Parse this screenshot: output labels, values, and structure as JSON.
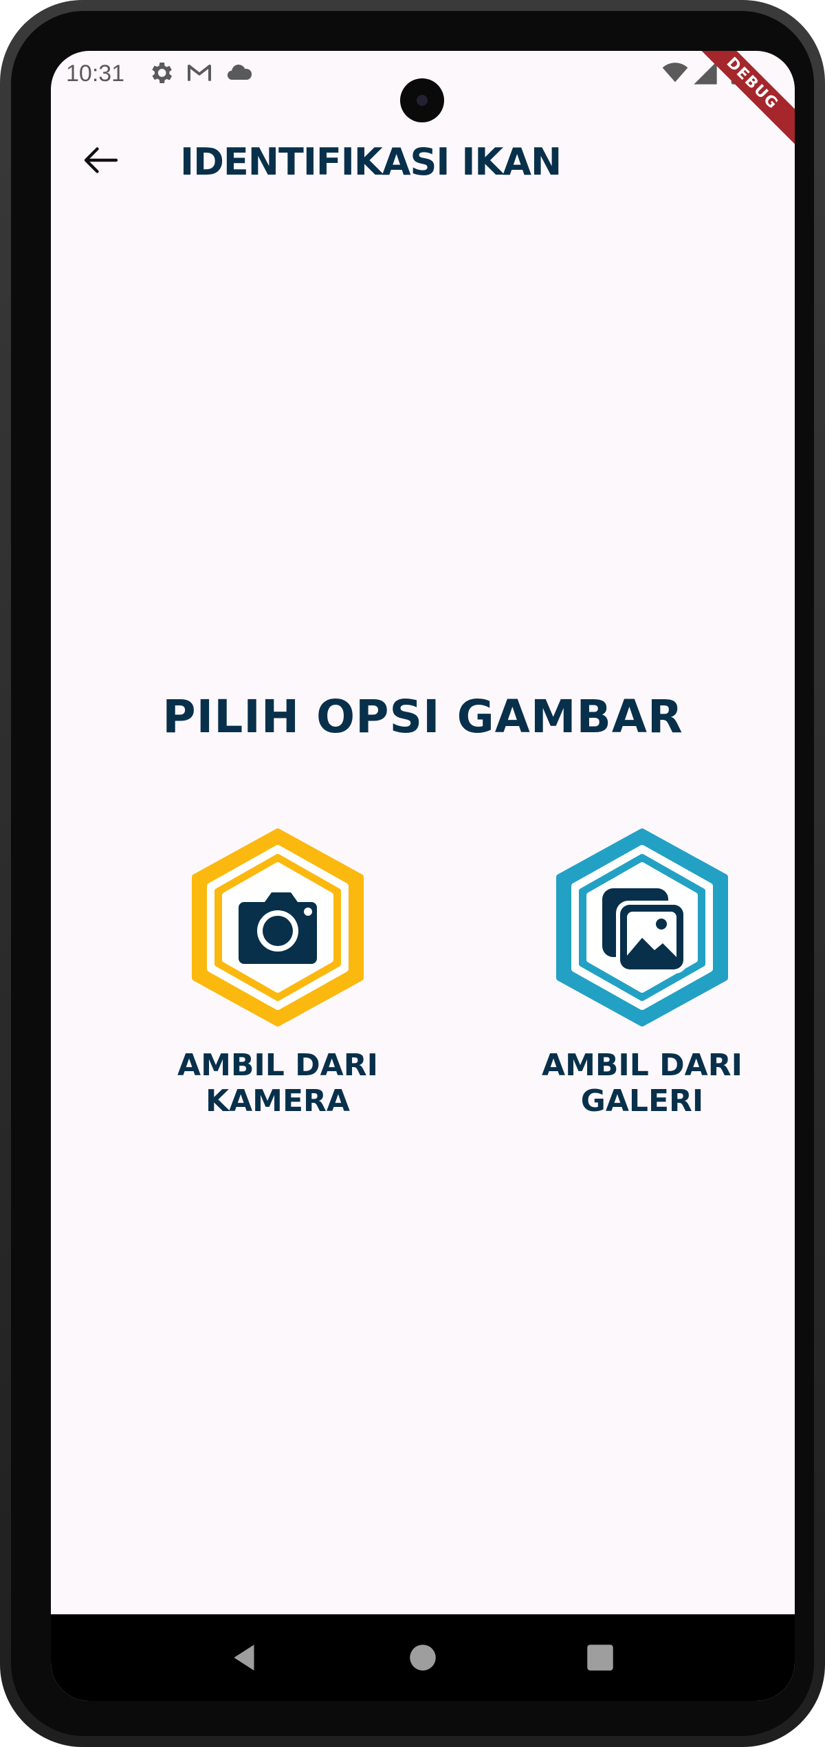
{
  "status_bar": {
    "time": "10:31",
    "icons": [
      "settings-icon",
      "gmail-icon",
      "cloud-icon",
      "wifi-icon",
      "signal-icon",
      "battery-icon"
    ]
  },
  "debug_banner": "DEBUG",
  "app_bar": {
    "title": "IDENTIFIKASI IKAN",
    "back_icon": "arrow-back-icon"
  },
  "content": {
    "heading": "PILIH OPSI GAMBAR",
    "options": [
      {
        "line1": "AMBIL DARI",
        "line2": "KAMERA",
        "icon": "camera-icon",
        "color": "#fbb80f"
      },
      {
        "line1": "AMBIL DARI",
        "line2": "GALERI",
        "icon": "gallery-icon",
        "color": "#22a1c4"
      }
    ]
  },
  "colors": {
    "title": "#08304b",
    "background": "#fdf8fc",
    "debug": "#a5262b"
  },
  "nav_bar": {
    "buttons": [
      "back-triangle-icon",
      "home-circle-icon",
      "recents-square-icon"
    ]
  }
}
